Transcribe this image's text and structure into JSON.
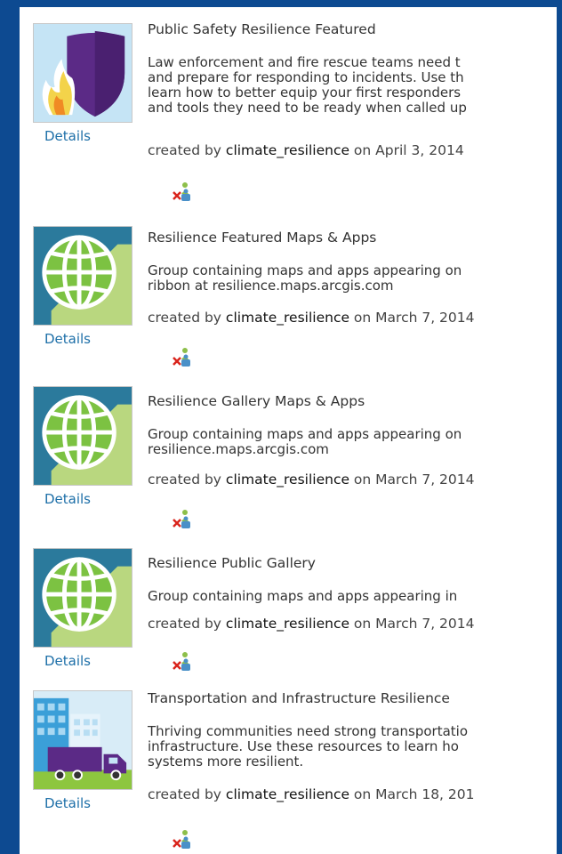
{
  "groups": [
    {
      "title": "Public Safety Resilience Featured",
      "description_lines": [
        "Law enforcement and fire rescue teams need t",
        "and prepare for responding to incidents. Use th",
        "learn how to better equip your first responders",
        "and tools they need to be ready when called up"
      ],
      "created_prefix": "created by ",
      "owner": "climate_resilience",
      "date_text": " on April 3, 2014",
      "details_label": "Details",
      "thumbnail_icon": "shield-flame-icon"
    },
    {
      "title": "Resilience Featured Maps & Apps",
      "description_lines": [
        "Group containing maps and apps appearing on",
        "ribbon at resilience.maps.arcgis.com"
      ],
      "created_prefix": "created by ",
      "owner": "climate_resilience",
      "date_text": " on March 7, 2014",
      "details_label": "Details",
      "thumbnail_icon": "globe-icon"
    },
    {
      "title": "Resilience Gallery Maps & Apps",
      "description_lines": [
        "Group containing maps and apps appearing on",
        "resilience.maps.arcgis.com"
      ],
      "created_prefix": "created by ",
      "owner": "climate_resilience",
      "date_text": " on March 7, 2014",
      "details_label": "Details",
      "thumbnail_icon": "globe-icon"
    },
    {
      "title": "Resilience Public Gallery",
      "description_lines": [
        "Group containing maps and apps appearing in"
      ],
      "created_prefix": "created by ",
      "owner": "climate_resilience",
      "date_text": " on March 7, 2014",
      "details_label": "Details",
      "thumbnail_icon": "globe-icon"
    },
    {
      "title": "Transportation and Infrastructure Resilience",
      "description_lines": [
        "Thriving communities need strong transportatio",
        "infrastructure. Use these resources to learn ho",
        "systems more resilient."
      ],
      "created_prefix": "created by ",
      "owner": "climate_resilience",
      "date_text": " on March 18, 201",
      "details_label": "Details",
      "thumbnail_icon": "truck-building-icon"
    }
  ],
  "colors": {
    "page_background": "#0d4a91",
    "link": "#1d6fa8",
    "globe_green": "#7cc242",
    "thumb_teal": "#2b7a9c"
  },
  "leave_group_icon": "leave-group-icon"
}
